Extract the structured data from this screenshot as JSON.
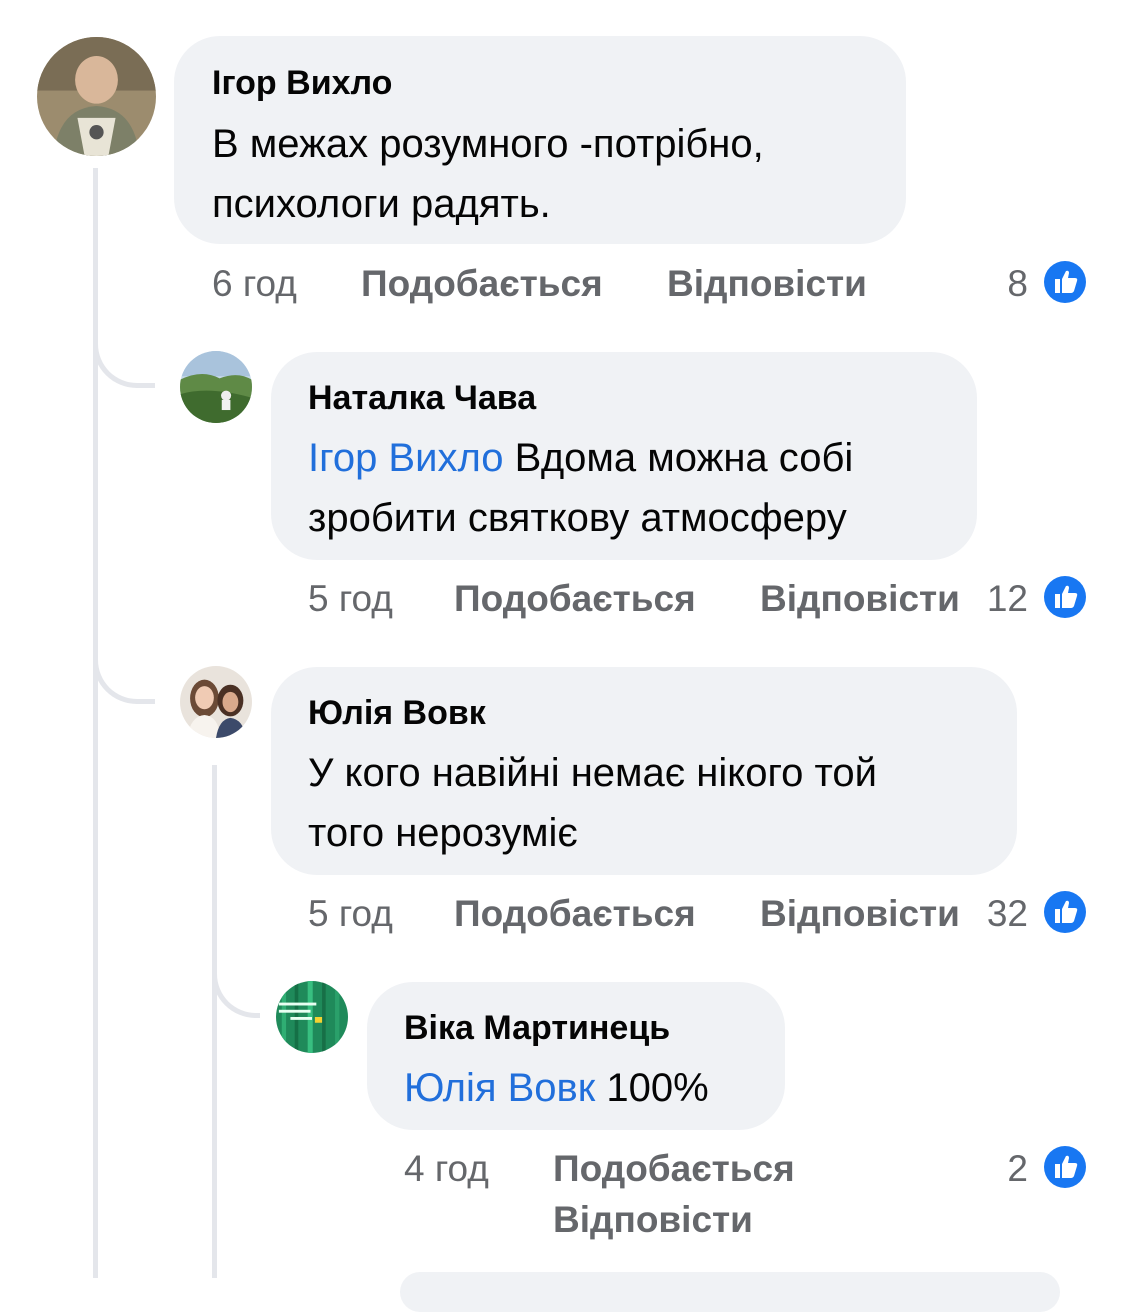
{
  "comments": [
    {
      "author": "Ігор Вихло",
      "mention": "",
      "line1": "В межах розумного -потрібно,",
      "line2": "психологи радять.",
      "time": "6 год",
      "like_label": "Подобається",
      "reply_label": "Відповісти",
      "reactions": "8"
    },
    {
      "author": "Наталка Чава",
      "mention": "Ігор Вихло",
      "line1_rest": " Вдома можна собі",
      "line2": "зробити святкову атмосферу",
      "time": "5 год",
      "like_label": "Подобається",
      "reply_label": "Відповісти",
      "reactions": "12"
    },
    {
      "author": "Юлія Вовк",
      "mention": "",
      "line1": "У кого навійні немає нікого той",
      "line2": "того нерозуміє",
      "time": "5 год",
      "like_label": "Подобається",
      "reply_label": "Відповісти",
      "reactions": "32"
    },
    {
      "author": "Віка Мартинець",
      "mention": "Юлія Вовк",
      "line1_rest": " 100%",
      "time": "4 год",
      "like_label": "Подобається",
      "reply_label": "Відповісти",
      "reactions": "2"
    }
  ],
  "colors": {
    "bubble": "#f0f2f5",
    "mention": "#216fdb",
    "meta": "#65676b",
    "like_badge": "#1877f2"
  },
  "icons": {
    "like": "thumbs-up-icon"
  }
}
